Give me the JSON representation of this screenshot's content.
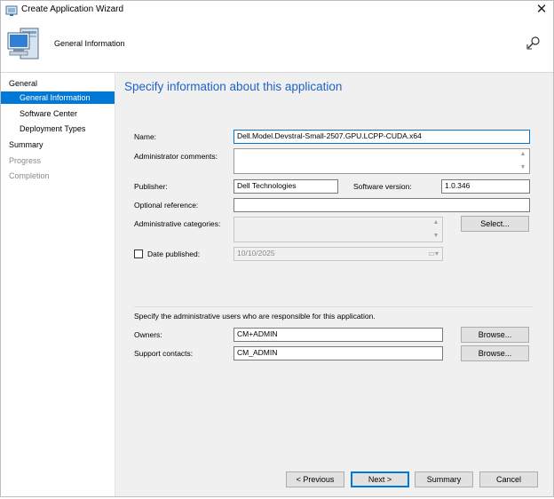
{
  "window": {
    "title": "Create Application Wizard",
    "close_icon": "close-icon",
    "header_title": "General Information"
  },
  "sidebar": {
    "items": [
      {
        "label": "General",
        "state": "normal"
      },
      {
        "label": "General Information",
        "state": "selected"
      },
      {
        "label": "Software Center",
        "state": "normal"
      },
      {
        "label": "Deployment Types",
        "state": "normal"
      },
      {
        "label": "Summary",
        "state": "normal"
      },
      {
        "label": "Progress",
        "state": "disabled"
      },
      {
        "label": "Completion",
        "state": "disabled"
      }
    ]
  },
  "main": {
    "heading": "Specify information about this application",
    "name_label": "Name:",
    "name_value": "Dell.Model.Devstral-Small-2507.GPU.LCPP-CUDA.x64",
    "admin_comments_label": "Administrator comments:",
    "publisher_label": "Publisher:",
    "publisher_value": "Dell Technologies",
    "software_version_label": "Software version:",
    "software_version_value": "1.0.346",
    "optional_reference_label": "Optional reference:",
    "admin_categories_label": "Administrative categories:",
    "select_button": "Select...",
    "date_published_label": "Date published:",
    "date_published_value": "10/10/2025",
    "admin_users_text": "Specify the administrative users who are responsible for this application.",
    "owners_label": "Owners:",
    "owners_value": "CM+ADMIN",
    "support_contacts_label": "Support contacts:",
    "support_contacts_value": "CM_ADMIN",
    "browse_button": "Browse..."
  },
  "footer": {
    "previous_button": "< Previous",
    "next_button": "Next >",
    "summary_button": "Summary",
    "cancel_button": "Cancel"
  }
}
